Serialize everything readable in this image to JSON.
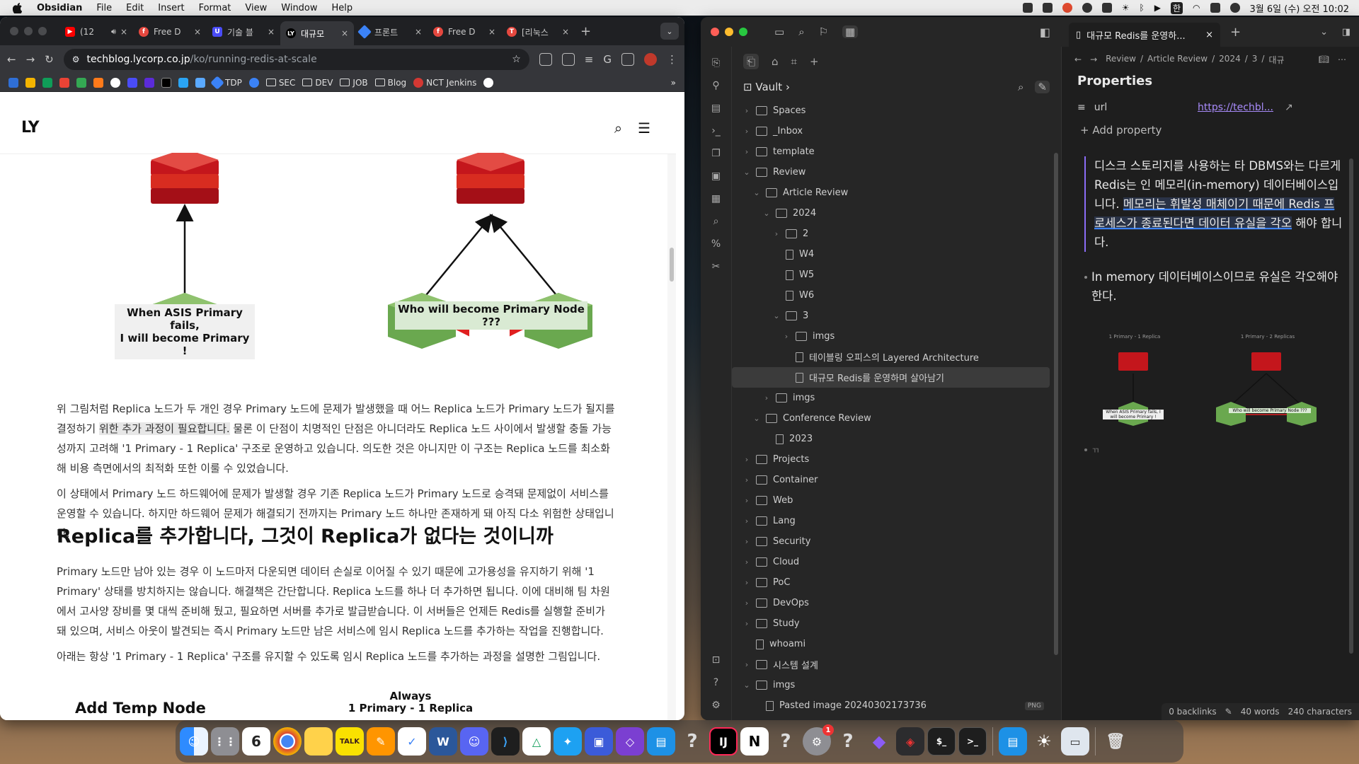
{
  "menubar": {
    "app": "Obsidian",
    "items": [
      "File",
      "Edit",
      "Insert",
      "Format",
      "View",
      "Window",
      "Help"
    ],
    "datetime": "3월 6일 (수) 오전 10:02",
    "input_method": "한"
  },
  "chrome": {
    "tabs": [
      {
        "title": "(12",
        "color": "#ff0000",
        "icon": "youtube-icon"
      },
      {
        "title": "Free D",
        "color": "#e5483f",
        "icon": "figma-icon"
      },
      {
        "title": "기술 블",
        "color": "#4a4cf7",
        "icon": "u-icon"
      },
      {
        "title": "대규모",
        "color": "#000000",
        "icon": "ly-icon",
        "active": true
      },
      {
        "title": "프론트",
        "color": "#3b82f6",
        "icon": "diamond-icon"
      },
      {
        "title": "Free D",
        "color": "#e5483f",
        "icon": "figma-icon"
      },
      {
        "title": "[리눅스",
        "color": "#e5483f",
        "icon": "t-icon"
      }
    ],
    "url_host": "techblog.lycorp.co.jp",
    "url_path": "/ko/running-redis-at-scale",
    "bookmarks": [
      "TDP",
      "SEC",
      "DEV",
      "JOB",
      "Blog",
      "NCT Jenkins"
    ]
  },
  "article": {
    "logo": "LY",
    "diagram_left_label": "When ASIS Primary fails,\nI will become Primary !",
    "diagram_right_label": "Who will become Primary Node ???",
    "p1_a": "위 그림처럼 Replica 노드가 두 개인 경우 Primary 노드에 문제가 발생했을 때 어느 Replica 노드가 Primary 노드가 될지를 결정하기 ",
    "p1_hl": "위한 추가 과정이 필요합니다.",
    "p1_b": " 물론 이 단점이 치명적인 단점은 아니더라도 Replica 노드 사이에서 발생할 충돌 가능성까지 고려해 '1 Primary - 1 Replica' 구조로 운영하고 있습니다. 의도한 것은 아니지만 이 구조는 Replica 노드를 최소화해 비용 측면에서의 최적화 또한 이룰 수 있었습니다.",
    "p2": "이 상태에서 Primary 노드 하드웨어에 문제가 발생할 경우 기존 Replica 노드가 Primary 노드로 승격돼 문제없이 서비스를 운영할 수 있습니다. 하지만 하드웨어 문제가 해결되기 전까지는 Primary 노드 하나만 존재하게 돼 아직 다소 위험한 상태입니다.",
    "h2": "Replica를 추가합니다, 그것이 Replica가 없다는 것이니까",
    "p3": "Primary 노드만 남아 있는 경우 이 노드마저 다운되면 데이터 손실로 이어질 수 있기 때문에 고가용성을 유지하기 위해 '1 Primary' 상태를 방치하지는 않습니다. 해결책은 간단합니다. Replica 노드를 하나 더 추가하면 됩니다. 이에 대비해 팀 차원에서 고사양 장비를 몇 대씩 준비해 뒀고, 필요하면 서버를 추가로 발급받습니다. 이 서버들은 언제든 Redis를 실행할 준비가 돼 있으며, 서비스 아웃이 발견되는 즉시 Primary 노드만 남은 서비스에 임시 Replica 노드를 추가하는 작업을 진행합니다.",
    "p4": "아래는 항상 '1 Primary - 1 Replica' 구조를 유지할 수 있도록 임시 Replica 노드를 추가하는 과정을 설명한 그림입니다.",
    "bottom_left": "Add Temp Node",
    "bottom_mid_1": "Always",
    "bottom_mid_2": "1 Primary - 1 Replica"
  },
  "obsidian": {
    "vault": "Vault",
    "tree": [
      {
        "label": "Spaces",
        "depth": 0,
        "type": "folder",
        "chev": "›"
      },
      {
        "label": "_Inbox",
        "depth": 0,
        "type": "folder",
        "chev": "›"
      },
      {
        "label": "template",
        "depth": 0,
        "type": "folder",
        "chev": "›"
      },
      {
        "label": "Review",
        "depth": 0,
        "type": "folder",
        "chev": "⌄"
      },
      {
        "label": "Article Review",
        "depth": 1,
        "type": "folder",
        "chev": "⌄"
      },
      {
        "label": "2024",
        "depth": 2,
        "type": "folder",
        "chev": "⌄"
      },
      {
        "label": "2",
        "depth": 3,
        "type": "folder",
        "chev": "›"
      },
      {
        "label": "W4",
        "depth": 3,
        "type": "doc",
        "chev": ""
      },
      {
        "label": "W5",
        "depth": 3,
        "type": "doc",
        "chev": ""
      },
      {
        "label": "W6",
        "depth": 3,
        "type": "doc",
        "chev": ""
      },
      {
        "label": "3",
        "depth": 3,
        "type": "folder",
        "chev": "⌄"
      },
      {
        "label": "imgs",
        "depth": 4,
        "type": "folder",
        "chev": "›"
      },
      {
        "label": "테이블링 오피스의 Layered Architecture",
        "depth": 4,
        "type": "doc",
        "chev": ""
      },
      {
        "label": "대규모 Redis를 운영하며 살아남기",
        "depth": 4,
        "type": "doc",
        "chev": "",
        "selected": true
      },
      {
        "label": "imgs",
        "depth": 2,
        "type": "folder",
        "chev": "›"
      },
      {
        "label": "Conference Review",
        "depth": 1,
        "type": "folder",
        "chev": "⌄"
      },
      {
        "label": "2023",
        "depth": 2,
        "type": "doc",
        "chev": ""
      },
      {
        "label": "Projects",
        "depth": 0,
        "type": "folder",
        "chev": "›"
      },
      {
        "label": "Container",
        "depth": 0,
        "type": "folder",
        "chev": "›"
      },
      {
        "label": "Web",
        "depth": 0,
        "type": "folder",
        "chev": "›"
      },
      {
        "label": "Lang",
        "depth": 0,
        "type": "folder",
        "chev": "›"
      },
      {
        "label": "Security",
        "depth": 0,
        "type": "folder",
        "chev": "›"
      },
      {
        "label": "Cloud",
        "depth": 0,
        "type": "folder",
        "chev": "›"
      },
      {
        "label": "PoC",
        "depth": 0,
        "type": "folder",
        "chev": "›"
      },
      {
        "label": "DevOps",
        "depth": 0,
        "type": "folder",
        "chev": "›"
      },
      {
        "label": "Study",
        "depth": 0,
        "type": "folder",
        "chev": "›"
      },
      {
        "label": "whoami",
        "depth": 0,
        "type": "doc",
        "chev": ""
      },
      {
        "label": "시스템 설계",
        "depth": 0,
        "type": "folder",
        "chev": "›"
      },
      {
        "label": "imgs",
        "depth": 0,
        "type": "folder",
        "chev": "⌄"
      },
      {
        "label": "Pasted image 20240302173736",
        "depth": 1,
        "type": "img",
        "chev": "",
        "badge": "PNG"
      }
    ],
    "editor_tab": "대규모 Redis를 운영하...",
    "breadcrumb": [
      "Review",
      "Article Review",
      "2024",
      "3",
      "대규"
    ],
    "properties_title": "Properties",
    "prop_key": "url",
    "prop_value": "https://techbl...",
    "add_property": "Add property",
    "quote_a": "디스크 스토리지를 사용하는 타 DBMS와는 다르게 Redis는 인 메모리(in-memory) 데이터베이스입니다. ",
    "quote_u": "메모리는 휘발성 매체이기 때문에 Redis 프로세스가 종료된다면 데이터 유실을 각오",
    "quote_b": " 해야 합니다.",
    "bullet": "In memory 데이터베이스이므로 유실은 각오해야 한다.",
    "mini_left_title": "1 Primary - 1 Replica",
    "mini_right_title": "1 Primary - 2 Replicas",
    "mini_left_label": "When ASIS Primary fails, I will become Primary !",
    "mini_right_label": "Who will become Primary Node ???",
    "bullet2": "ㄲ",
    "status_backlinks": "0 backlinks",
    "status_words": "40 words",
    "status_chars": "240 characters"
  },
  "dock": {
    "calendar_day": "6",
    "badge": "1"
  }
}
